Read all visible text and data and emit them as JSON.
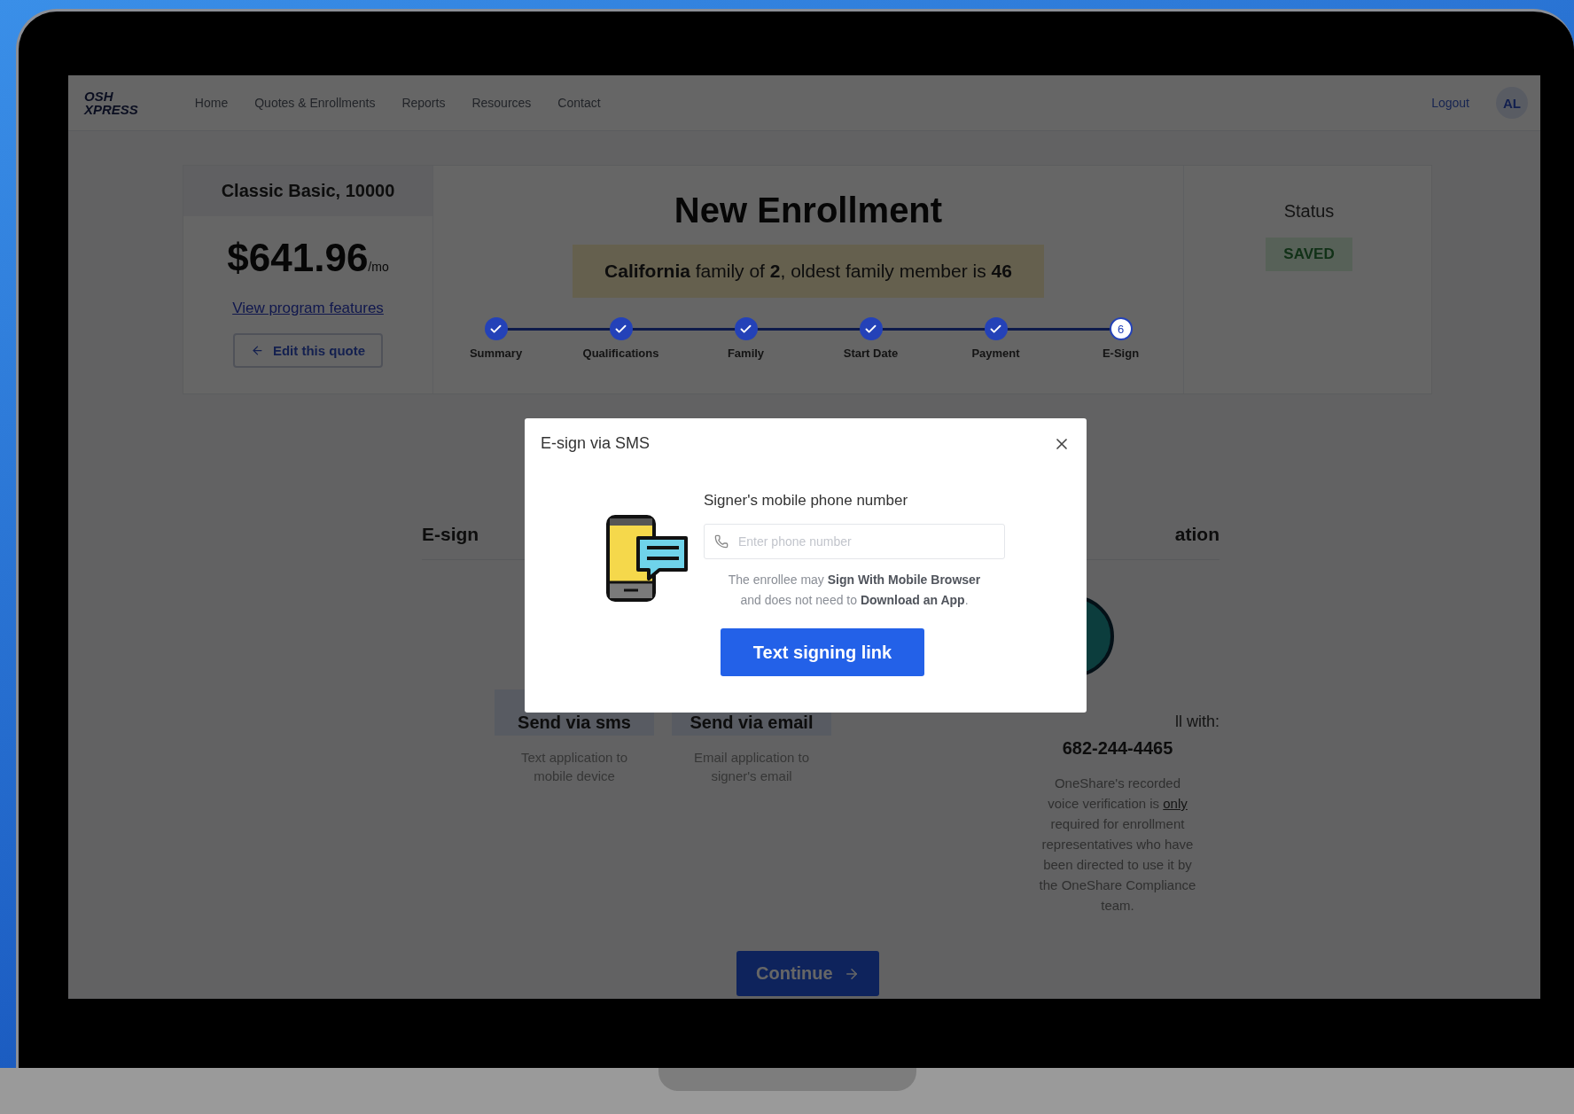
{
  "nav": {
    "logo": [
      "OSH",
      "XPRESS"
    ],
    "links": [
      "Home",
      "Quotes & Enrollments",
      "Reports",
      "Resources",
      "Contact"
    ],
    "logout": "Logout",
    "avatar": "AL"
  },
  "quote": {
    "plan": "Classic Basic, 10000",
    "price": "$641.96",
    "per": "/mo",
    "features_link": "View program features",
    "edit_button": "Edit this quote"
  },
  "enrollment": {
    "title": "New Enrollment",
    "banner": "**California** family of **2**, oldest family member is **46**",
    "steps": [
      {
        "label": "Summary",
        "done": true
      },
      {
        "label": "Qualifications",
        "done": true
      },
      {
        "label": "Family",
        "done": true
      },
      {
        "label": "Start Date",
        "done": true
      },
      {
        "label": "Payment",
        "done": true
      },
      {
        "label": "E-Sign",
        "done": false,
        "number": "6"
      }
    ]
  },
  "status": {
    "label": "Status",
    "badge": "SAVED"
  },
  "esign": {
    "heading": "E-sign",
    "options": [
      {
        "button": "Send via sms",
        "caption": "Text application to mobile device"
      },
      {
        "button": "Send via email",
        "caption": "Email application to signer's email"
      }
    ]
  },
  "verification": {
    "heading": "ation",
    "call_line": "ll with:",
    "phone": "682-244-4465",
    "note": [
      {
        "text": "OneShare's recorded voice verification is ",
        "underline": false
      },
      {
        "text": "only",
        "underline": true
      },
      {
        "text": " required for enrollment representatives who have been directed to use it by the OneShare Compliance team.",
        "underline": false
      }
    ]
  },
  "continue_button": "Continue",
  "modal": {
    "title": "E-sign via SMS",
    "field_label": "Signer's mobile phone number",
    "placeholder": "Enter phone number",
    "note": "The enrollee may **Sign With Mobile Browser** and does not need to **Download an App**.",
    "button": "Text signing link"
  }
}
